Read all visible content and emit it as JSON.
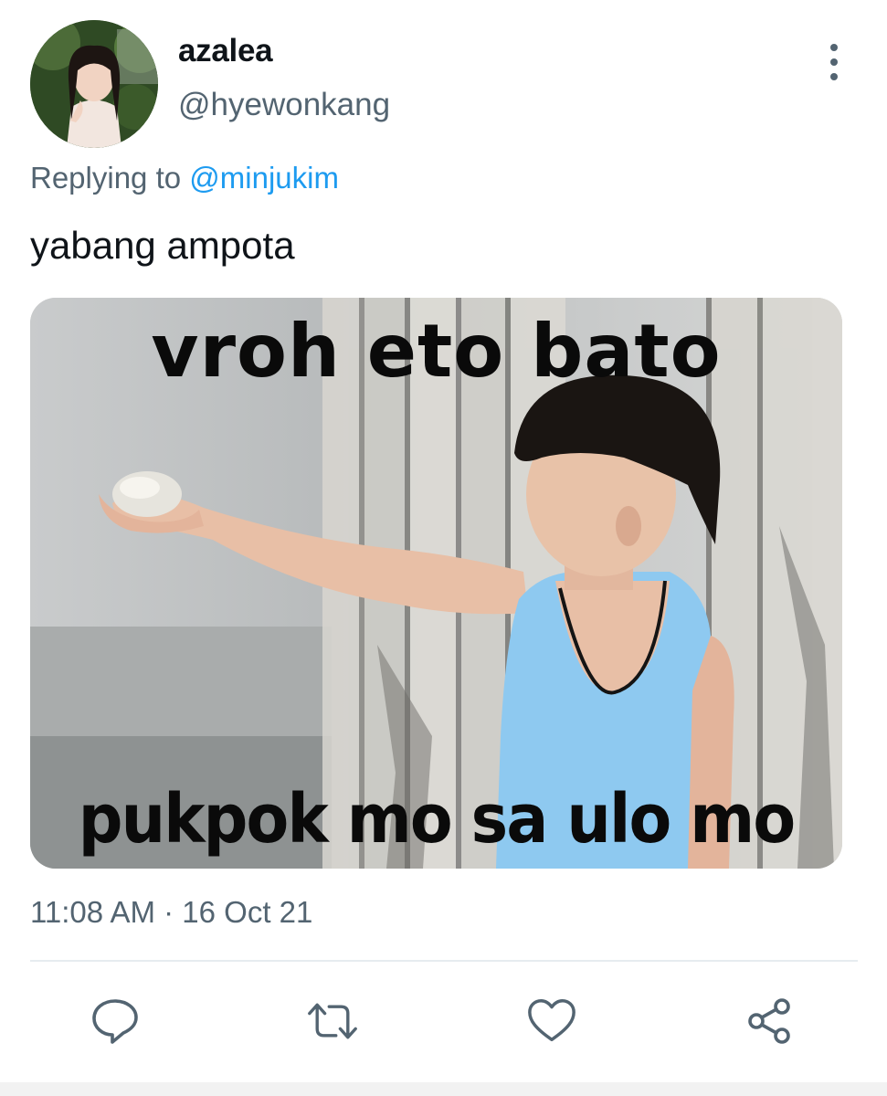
{
  "author": {
    "display_name": "azalea",
    "handle": "@hyewonkang"
  },
  "reply": {
    "prefix": "Replying to ",
    "mention": "@minjukim"
  },
  "tweet": {
    "text": "yabang ampota",
    "timestamp": "11:08 AM · 16 Oct 21"
  },
  "media": {
    "caption_top": "vroh eto bato",
    "caption_bottom": "pukpok mo sa ulo mo"
  },
  "icons": {
    "more": "more-vertical-icon",
    "reply": "comment-icon",
    "retweet": "retweet-icon",
    "like": "heart-icon",
    "share": "share-icon"
  },
  "colors": {
    "text_primary": "#0f1419",
    "text_secondary": "#536471",
    "link": "#1d9bf0",
    "divider": "#e6ecf0"
  }
}
